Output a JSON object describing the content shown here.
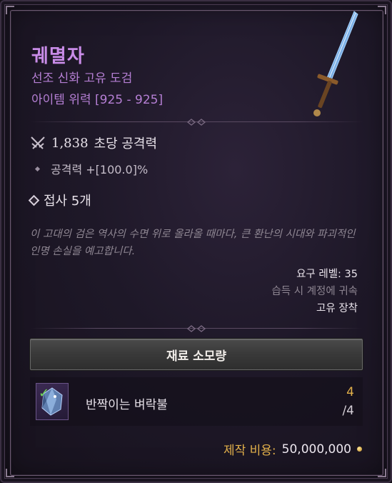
{
  "item": {
    "name": "궤멸자",
    "type": "선조 신화 고유 도검",
    "item_power": "아이템 위력 [925 - 925]"
  },
  "stats": {
    "dps_value": "1,838",
    "dps_label": "초당 공격력",
    "affix": "공격력 +[100.0]%"
  },
  "sockets": {
    "label": "접사 5개"
  },
  "flavor": "이 고대의 검은 역사의 수면 위로 올라올 때마다, 큰 환난의 시대와 파괴적인 인명 손실을 예고합니다.",
  "requirements": {
    "level": "요구 레벨: 35",
    "bind": "습득 시 계정에 귀속",
    "equip": "고유 장착"
  },
  "materials": {
    "button_label": "재료 소모량",
    "items": [
      {
        "name": "반짝이는 벼락불",
        "have": "4",
        "need": "/4",
        "satisfied": true
      }
    ]
  },
  "cost": {
    "label": "제작 비용:",
    "value": "50,000,000"
  },
  "colors": {
    "unique": "#c98ce8",
    "gold": "#e2b04a",
    "check": "#6fd65a"
  },
  "icons": [
    "sword-icon",
    "crossed-swords-icon",
    "socket-icon",
    "gem-icon",
    "check-icon",
    "gold-coin-icon"
  ]
}
